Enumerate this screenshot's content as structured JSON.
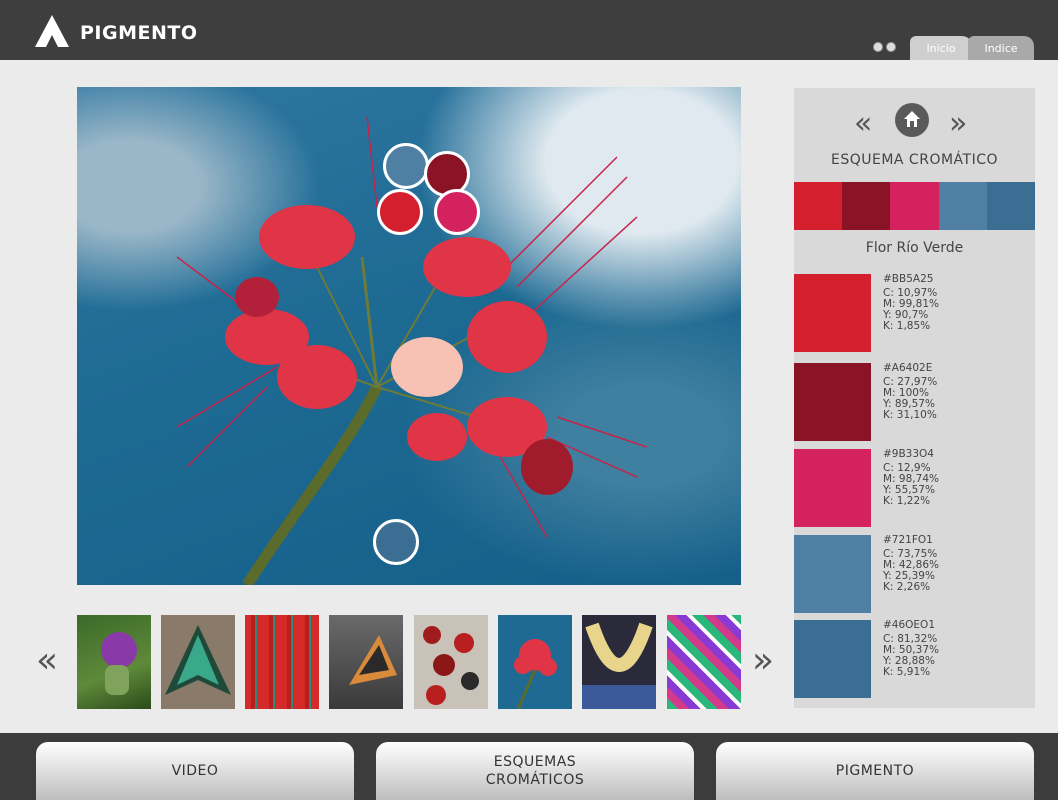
{
  "header": {
    "brand": "PIGMENTO",
    "tabs": [
      {
        "label": "Inicio"
      },
      {
        "label": "Indice"
      }
    ],
    "icons": [
      "settings-icon",
      "sound-icon"
    ]
  },
  "panel": {
    "scheme_title": "ESQUEMA CROMÁTICO",
    "photo_name": "Flor Río Verde",
    "scheme_colors": [
      "#d41f2e",
      "#8a1426",
      "#d4225f",
      "#4f7fa3",
      "#3c6d93"
    ],
    "swatches": [
      {
        "hex": "#BB5A25",
        "c": "C: 10,97%",
        "m": "M: 99,81%",
        "y": "Y: 90,7%",
        "k": "K: 1,85%",
        "color": "#d41f2e"
      },
      {
        "hex": "#A6402E",
        "c": "C: 27,97%",
        "m": "M: 100%",
        "y": "Y: 89,57%",
        "k": "K: 31,10%",
        "color": "#8a1426"
      },
      {
        "hex": "#9B33O4",
        "c": "C: 12,9%",
        "m": "M: 98,74%",
        "y": "Y: 55,57%",
        "k": "K: 1,22%",
        "color": "#d4225f"
      },
      {
        "hex": "#721FO1",
        "c": "C: 73,75%",
        "m": "M: 42,86%",
        "y": "Y: 25,39%",
        "k": "K: 2,26%",
        "color": "#4f7fa3"
      },
      {
        "hex": "#46OEO1",
        "c": "C: 81,32%",
        "m": "M: 50,37%",
        "y": "Y: 28,88%",
        "k": "K: 5,91%",
        "color": "#3c6d93"
      }
    ]
  },
  "thumbnails": [
    "thistle-photo",
    "moth-photo",
    "threads-photo",
    "butterfly-photo",
    "seed-necklace-photo",
    "flower-photo",
    "beaded-necklace-photo",
    "woven-bag-photo"
  ],
  "footer": {
    "buttons": [
      {
        "label": "VIDEO"
      },
      {
        "label": "ESQUEMAS CROMÁTICOS"
      },
      {
        "label": "PIGMENTO"
      }
    ]
  }
}
